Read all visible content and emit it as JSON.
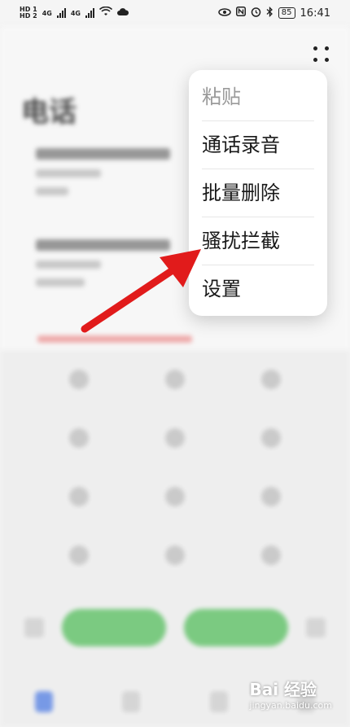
{
  "status_bar": {
    "sim1": "HD 1",
    "sim2": "HD 2",
    "network1": "4G",
    "network2": "4G",
    "battery": "85",
    "time": "16:41"
  },
  "menu": {
    "items": [
      {
        "label": "粘贴",
        "enabled": false
      },
      {
        "label": "通话录音",
        "enabled": true
      },
      {
        "label": "批量删除",
        "enabled": true
      },
      {
        "label": "骚扰拦截",
        "enabled": true
      },
      {
        "label": "设置",
        "enabled": true
      }
    ]
  },
  "background": {
    "title": "电话"
  },
  "watermark": {
    "brand": "Bai 经验",
    "sub": "jingyan.baidu.com"
  },
  "colors": {
    "arrow": "#e11b1b",
    "call_green": "#4cba55",
    "active_tab": "#3d6fe0"
  }
}
